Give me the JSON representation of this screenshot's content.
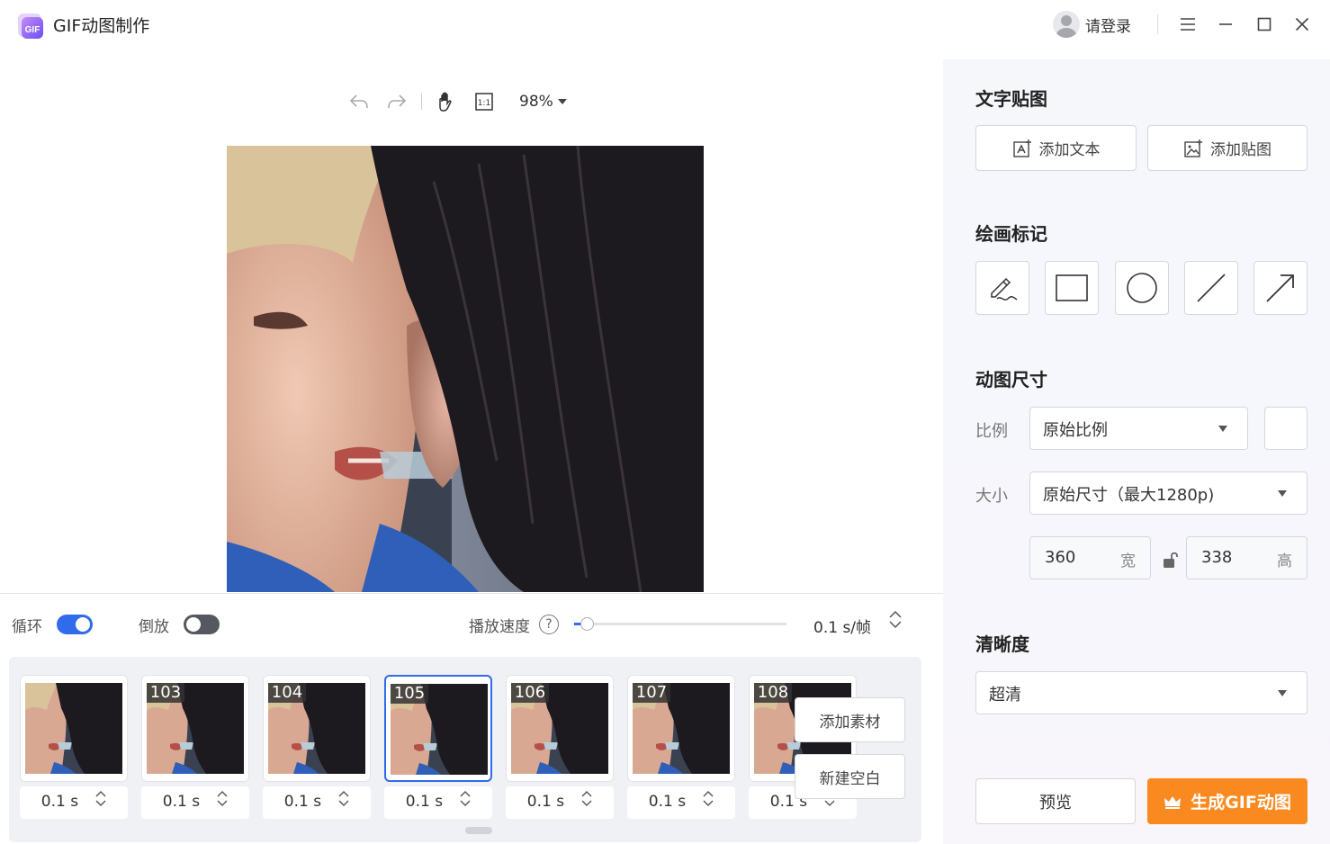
{
  "app": {
    "title": "GIF动图制作",
    "logo_text": "GIF"
  },
  "user": {
    "login_label": "请登录"
  },
  "toolbar": {
    "zoom": "98%"
  },
  "playback": {
    "loop_label": "循环",
    "loop_on": true,
    "reverse_label": "倒放",
    "reverse_on": false,
    "speed_label": "播放速度",
    "help_symbol": "?",
    "speed_value": "0.1 s/帧",
    "speed_slider_fraction": 0.06
  },
  "frames": [
    {
      "number": "",
      "duration": "0.1 s",
      "selected": false
    },
    {
      "number": "103",
      "duration": "0.1 s",
      "selected": false
    },
    {
      "number": "104",
      "duration": "0.1 s",
      "selected": false
    },
    {
      "number": "105",
      "duration": "0.1 s",
      "selected": true
    },
    {
      "number": "106",
      "duration": "0.1 s",
      "selected": false
    },
    {
      "number": "107",
      "duration": "0.1 s",
      "selected": false
    },
    {
      "number": "108",
      "duration": "0.1 s",
      "selected": false
    }
  ],
  "strip_actions": {
    "add_material": "添加素材",
    "new_blank": "新建空白"
  },
  "panel": {
    "text_sticker": {
      "title": "文字贴图",
      "add_text": "添加文本",
      "add_sticker": "添加贴图"
    },
    "drawing": {
      "title": "绘画标记",
      "tools": [
        "pen-icon",
        "rectangle-icon",
        "circle-icon",
        "line-icon",
        "arrow-icon"
      ]
    },
    "size": {
      "title": "动图尺寸",
      "ratio_label": "比例",
      "ratio_value": "原始比例",
      "size_label": "大小",
      "size_value": "原始尺寸（最大1280p)",
      "width": "360",
      "width_unit": "宽",
      "height": "338",
      "height_unit": "高"
    },
    "quality": {
      "title": "清晰度",
      "value": "超清"
    },
    "preview_label": "预览",
    "generate_label": "生成GIF动图"
  },
  "colors": {
    "accent": "#2f6bea",
    "generate": "#fa8a1f"
  }
}
